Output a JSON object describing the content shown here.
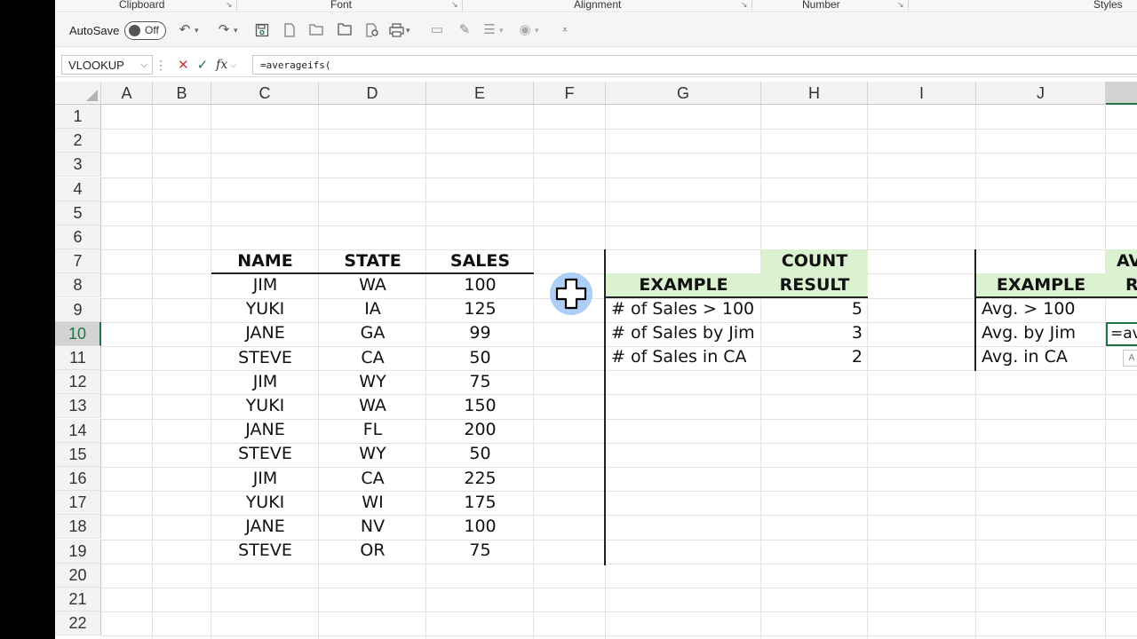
{
  "ribbon_groups": [
    "Clipboard",
    "Font",
    "Alignment",
    "Number",
    "Styles"
  ],
  "qat": {
    "autosave_label": "AutoSave",
    "toggle_state": "Off"
  },
  "formula_bar": {
    "name_box": "VLOOKUP",
    "fx": "fx",
    "formula": "=averageifs("
  },
  "columns": [
    "A",
    "B",
    "C",
    "D",
    "E",
    "F",
    "G",
    "H",
    "I",
    "J"
  ],
  "rows": [
    "1",
    "2",
    "3",
    "4",
    "5",
    "6",
    "7",
    "8",
    "9",
    "10",
    "11",
    "12",
    "13",
    "14",
    "15",
    "16",
    "17",
    "18",
    "19",
    "20",
    "21",
    "22"
  ],
  "selected_row": "10",
  "sales_table": {
    "headers": [
      "NAME",
      "STATE",
      "SALES"
    ],
    "rows": [
      [
        "JIM",
        "WA",
        "100"
      ],
      [
        "YUKI",
        "IA",
        "125"
      ],
      [
        "JANE",
        "GA",
        "99"
      ],
      [
        "STEVE",
        "CA",
        "50"
      ],
      [
        "JIM",
        "WY",
        "75"
      ],
      [
        "YUKI",
        "WA",
        "150"
      ],
      [
        "JANE",
        "FL",
        "200"
      ],
      [
        "STEVE",
        "WY",
        "50"
      ],
      [
        "JIM",
        "CA",
        "225"
      ],
      [
        "YUKI",
        "WI",
        "175"
      ],
      [
        "JANE",
        "NV",
        "100"
      ],
      [
        "STEVE",
        "OR",
        "75"
      ]
    ]
  },
  "count_table": {
    "header_example": "EXAMPLE",
    "header_result_1": "COUNT",
    "header_result_2": "RESULT",
    "rows": [
      {
        "example": "# of Sales > 100",
        "result": "5"
      },
      {
        "example": "# of Sales by Jim",
        "result": "3"
      },
      {
        "example": "# of Sales in CA",
        "result": "2"
      }
    ]
  },
  "avg_table": {
    "header_example": "EXAMPLE",
    "header_result_1": "AV",
    "header_result_2": "R",
    "rows": [
      {
        "example": "Avg. > 100"
      },
      {
        "example": "Avg. by Jim"
      },
      {
        "example": "Avg. in CA"
      }
    ]
  },
  "active_cell": {
    "content": "=av"
  },
  "autocomplete_tip": "A",
  "colors": {
    "header_fill": "#daf2d0",
    "accent": "#217346"
  }
}
